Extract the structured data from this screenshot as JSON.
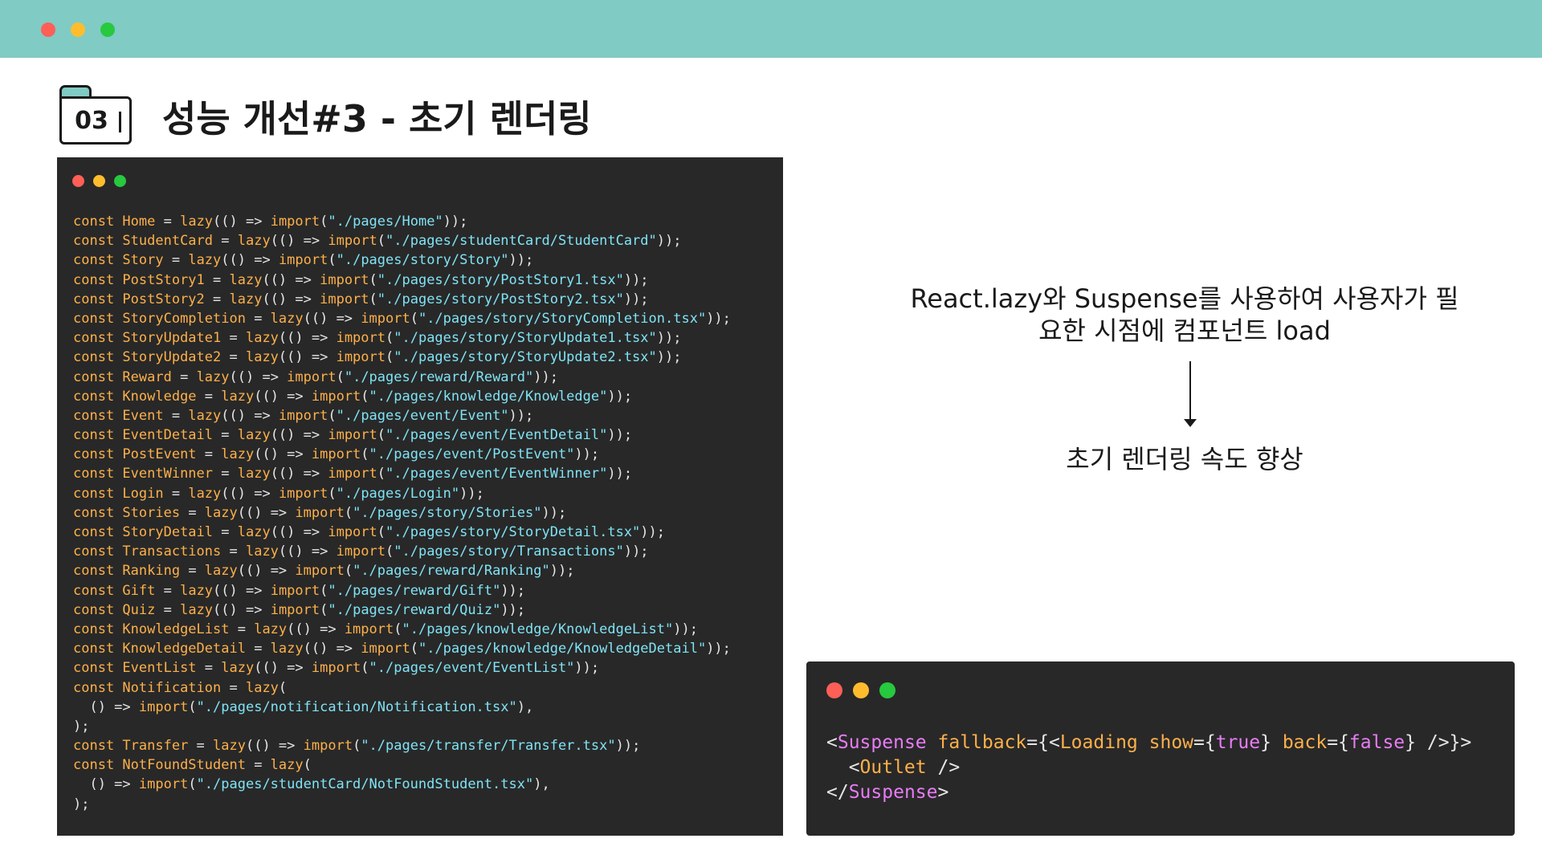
{
  "slide": {
    "section_number": "03",
    "title": "성능 개선#3 - 초기 렌더링"
  },
  "colors": {
    "topbar": "#80cbc4",
    "code_bg": "#282828",
    "keyword": "#fdb04a",
    "string": "#7fe3f5",
    "jsx_tag": "#e87cf5"
  },
  "left_code": {
    "lines": [
      [
        [
          "kw",
          "const "
        ],
        [
          "id",
          "Home"
        ],
        [
          "pn",
          " = "
        ],
        [
          "fn",
          "lazy"
        ],
        [
          "pn",
          "(() => "
        ],
        [
          "fn",
          "import"
        ],
        [
          "pn",
          "("
        ],
        [
          "str",
          "\"./pages/Home\""
        ],
        [
          "pn",
          "));"
        ]
      ],
      [
        [
          "kw",
          "const "
        ],
        [
          "id",
          "StudentCard"
        ],
        [
          "pn",
          " = "
        ],
        [
          "fn",
          "lazy"
        ],
        [
          "pn",
          "(() => "
        ],
        [
          "fn",
          "import"
        ],
        [
          "pn",
          "("
        ],
        [
          "str",
          "\"./pages/studentCard/StudentCard\""
        ],
        [
          "pn",
          "));"
        ]
      ],
      [
        [
          "kw",
          "const "
        ],
        [
          "id",
          "Story"
        ],
        [
          "pn",
          " = "
        ],
        [
          "fn",
          "lazy"
        ],
        [
          "pn",
          "(() => "
        ],
        [
          "fn",
          "import"
        ],
        [
          "pn",
          "("
        ],
        [
          "str",
          "\"./pages/story/Story\""
        ],
        [
          "pn",
          "));"
        ]
      ],
      [
        [
          "kw",
          "const "
        ],
        [
          "id",
          "PostStory1"
        ],
        [
          "pn",
          " = "
        ],
        [
          "fn",
          "lazy"
        ],
        [
          "pn",
          "(() => "
        ],
        [
          "fn",
          "import"
        ],
        [
          "pn",
          "("
        ],
        [
          "str",
          "\"./pages/story/PostStory1.tsx\""
        ],
        [
          "pn",
          "));"
        ]
      ],
      [
        [
          "kw",
          "const "
        ],
        [
          "id",
          "PostStory2"
        ],
        [
          "pn",
          " = "
        ],
        [
          "fn",
          "lazy"
        ],
        [
          "pn",
          "(() => "
        ],
        [
          "fn",
          "import"
        ],
        [
          "pn",
          "("
        ],
        [
          "str",
          "\"./pages/story/PostStory2.tsx\""
        ],
        [
          "pn",
          "));"
        ]
      ],
      [
        [
          "kw",
          "const "
        ],
        [
          "id",
          "StoryCompletion"
        ],
        [
          "pn",
          " = "
        ],
        [
          "fn",
          "lazy"
        ],
        [
          "pn",
          "(() => "
        ],
        [
          "fn",
          "import"
        ],
        [
          "pn",
          "("
        ],
        [
          "str",
          "\"./pages/story/StoryCompletion.tsx\""
        ],
        [
          "pn",
          "));"
        ]
      ],
      [
        [
          "kw",
          "const "
        ],
        [
          "id",
          "StoryUpdate1"
        ],
        [
          "pn",
          " = "
        ],
        [
          "fn",
          "lazy"
        ],
        [
          "pn",
          "(() => "
        ],
        [
          "fn",
          "import"
        ],
        [
          "pn",
          "("
        ],
        [
          "str",
          "\"./pages/story/StoryUpdate1.tsx\""
        ],
        [
          "pn",
          "));"
        ]
      ],
      [
        [
          "kw",
          "const "
        ],
        [
          "id",
          "StoryUpdate2"
        ],
        [
          "pn",
          " = "
        ],
        [
          "fn",
          "lazy"
        ],
        [
          "pn",
          "(() => "
        ],
        [
          "fn",
          "import"
        ],
        [
          "pn",
          "("
        ],
        [
          "str",
          "\"./pages/story/StoryUpdate2.tsx\""
        ],
        [
          "pn",
          "));"
        ]
      ],
      [
        [
          "kw",
          "const "
        ],
        [
          "id",
          "Reward"
        ],
        [
          "pn",
          " = "
        ],
        [
          "fn",
          "lazy"
        ],
        [
          "pn",
          "(() => "
        ],
        [
          "fn",
          "import"
        ],
        [
          "pn",
          "("
        ],
        [
          "str",
          "\"./pages/reward/Reward\""
        ],
        [
          "pn",
          "));"
        ]
      ],
      [
        [
          "kw",
          "const "
        ],
        [
          "id",
          "Knowledge"
        ],
        [
          "pn",
          " = "
        ],
        [
          "fn",
          "lazy"
        ],
        [
          "pn",
          "(() => "
        ],
        [
          "fn",
          "import"
        ],
        [
          "pn",
          "("
        ],
        [
          "str",
          "\"./pages/knowledge/Knowledge\""
        ],
        [
          "pn",
          "));"
        ]
      ],
      [
        [
          "kw",
          "const "
        ],
        [
          "id",
          "Event"
        ],
        [
          "pn",
          " = "
        ],
        [
          "fn",
          "lazy"
        ],
        [
          "pn",
          "(() => "
        ],
        [
          "fn",
          "import"
        ],
        [
          "pn",
          "("
        ],
        [
          "str",
          "\"./pages/event/Event\""
        ],
        [
          "pn",
          "));"
        ]
      ],
      [
        [
          "kw",
          "const "
        ],
        [
          "id",
          "EventDetail"
        ],
        [
          "pn",
          " = "
        ],
        [
          "fn",
          "lazy"
        ],
        [
          "pn",
          "(() => "
        ],
        [
          "fn",
          "import"
        ],
        [
          "pn",
          "("
        ],
        [
          "str",
          "\"./pages/event/EventDetail\""
        ],
        [
          "pn",
          "));"
        ]
      ],
      [
        [
          "kw",
          "const "
        ],
        [
          "id",
          "PostEvent"
        ],
        [
          "pn",
          " = "
        ],
        [
          "fn",
          "lazy"
        ],
        [
          "pn",
          "(() => "
        ],
        [
          "fn",
          "import"
        ],
        [
          "pn",
          "("
        ],
        [
          "str",
          "\"./pages/event/PostEvent\""
        ],
        [
          "pn",
          "));"
        ]
      ],
      [
        [
          "kw",
          "const "
        ],
        [
          "id",
          "EventWinner"
        ],
        [
          "pn",
          " = "
        ],
        [
          "fn",
          "lazy"
        ],
        [
          "pn",
          "(() => "
        ],
        [
          "fn",
          "import"
        ],
        [
          "pn",
          "("
        ],
        [
          "str",
          "\"./pages/event/EventWinner\""
        ],
        [
          "pn",
          "));"
        ]
      ],
      [
        [
          "kw",
          "const "
        ],
        [
          "id",
          "Login"
        ],
        [
          "pn",
          " = "
        ],
        [
          "fn",
          "lazy"
        ],
        [
          "pn",
          "(() => "
        ],
        [
          "fn",
          "import"
        ],
        [
          "pn",
          "("
        ],
        [
          "str",
          "\"./pages/Login\""
        ],
        [
          "pn",
          "));"
        ]
      ],
      [
        [
          "kw",
          "const "
        ],
        [
          "id",
          "Stories"
        ],
        [
          "pn",
          " = "
        ],
        [
          "fn",
          "lazy"
        ],
        [
          "pn",
          "(() => "
        ],
        [
          "fn",
          "import"
        ],
        [
          "pn",
          "("
        ],
        [
          "str",
          "\"./pages/story/Stories\""
        ],
        [
          "pn",
          "));"
        ]
      ],
      [
        [
          "kw",
          "const "
        ],
        [
          "id",
          "StoryDetail"
        ],
        [
          "pn",
          " = "
        ],
        [
          "fn",
          "lazy"
        ],
        [
          "pn",
          "(() => "
        ],
        [
          "fn",
          "import"
        ],
        [
          "pn",
          "("
        ],
        [
          "str",
          "\"./pages/story/StoryDetail.tsx\""
        ],
        [
          "pn",
          "));"
        ]
      ],
      [
        [
          "kw",
          "const "
        ],
        [
          "id",
          "Transactions"
        ],
        [
          "pn",
          " = "
        ],
        [
          "fn",
          "lazy"
        ],
        [
          "pn",
          "(() => "
        ],
        [
          "fn",
          "import"
        ],
        [
          "pn",
          "("
        ],
        [
          "str",
          "\"./pages/story/Transactions\""
        ],
        [
          "pn",
          "));"
        ]
      ],
      [
        [
          "kw",
          "const "
        ],
        [
          "id",
          "Ranking"
        ],
        [
          "pn",
          " = "
        ],
        [
          "fn",
          "lazy"
        ],
        [
          "pn",
          "(() => "
        ],
        [
          "fn",
          "import"
        ],
        [
          "pn",
          "("
        ],
        [
          "str",
          "\"./pages/reward/Ranking\""
        ],
        [
          "pn",
          "));"
        ]
      ],
      [
        [
          "kw",
          "const "
        ],
        [
          "id",
          "Gift"
        ],
        [
          "pn",
          " = "
        ],
        [
          "fn",
          "lazy"
        ],
        [
          "pn",
          "(() => "
        ],
        [
          "fn",
          "import"
        ],
        [
          "pn",
          "("
        ],
        [
          "str",
          "\"./pages/reward/Gift\""
        ],
        [
          "pn",
          "));"
        ]
      ],
      [
        [
          "kw",
          "const "
        ],
        [
          "id",
          "Quiz"
        ],
        [
          "pn",
          " = "
        ],
        [
          "fn",
          "lazy"
        ],
        [
          "pn",
          "(() => "
        ],
        [
          "fn",
          "import"
        ],
        [
          "pn",
          "("
        ],
        [
          "str",
          "\"./pages/reward/Quiz\""
        ],
        [
          "pn",
          "));"
        ]
      ],
      [
        [
          "kw",
          "const "
        ],
        [
          "id",
          "KnowledgeList"
        ],
        [
          "pn",
          " = "
        ],
        [
          "fn",
          "lazy"
        ],
        [
          "pn",
          "(() => "
        ],
        [
          "fn",
          "import"
        ],
        [
          "pn",
          "("
        ],
        [
          "str",
          "\"./pages/knowledge/KnowledgeList\""
        ],
        [
          "pn",
          "));"
        ]
      ],
      [
        [
          "kw",
          "const "
        ],
        [
          "id",
          "KnowledgeDetail"
        ],
        [
          "pn",
          " = "
        ],
        [
          "fn",
          "lazy"
        ],
        [
          "pn",
          "(() => "
        ],
        [
          "fn",
          "import"
        ],
        [
          "pn",
          "("
        ],
        [
          "str",
          "\"./pages/knowledge/KnowledgeDetail\""
        ],
        [
          "pn",
          "));"
        ]
      ],
      [
        [
          "kw",
          "const "
        ],
        [
          "id",
          "EventList"
        ],
        [
          "pn",
          " = "
        ],
        [
          "fn",
          "lazy"
        ],
        [
          "pn",
          "(() => "
        ],
        [
          "fn",
          "import"
        ],
        [
          "pn",
          "("
        ],
        [
          "str",
          "\"./pages/event/EventList\""
        ],
        [
          "pn",
          "));"
        ]
      ],
      [
        [
          "kw",
          "const "
        ],
        [
          "id",
          "Notification"
        ],
        [
          "pn",
          " = "
        ],
        [
          "fn",
          "lazy"
        ],
        [
          "pn",
          "("
        ]
      ],
      [
        [
          "pn",
          "  () => "
        ],
        [
          "fn",
          "import"
        ],
        [
          "pn",
          "("
        ],
        [
          "str",
          "\"./pages/notification/Notification.tsx\""
        ],
        [
          "pn",
          "),"
        ]
      ],
      [
        [
          "pn",
          ");"
        ]
      ],
      [
        [
          "kw",
          "const "
        ],
        [
          "id",
          "Transfer"
        ],
        [
          "pn",
          " = "
        ],
        [
          "fn",
          "lazy"
        ],
        [
          "pn",
          "(() => "
        ],
        [
          "fn",
          "import"
        ],
        [
          "pn",
          "("
        ],
        [
          "str",
          "\"./pages/transfer/Transfer.tsx\""
        ],
        [
          "pn",
          "));"
        ]
      ],
      [
        [
          "kw",
          "const "
        ],
        [
          "id",
          "NotFoundStudent"
        ],
        [
          "pn",
          " = "
        ],
        [
          "fn",
          "lazy"
        ],
        [
          "pn",
          "("
        ]
      ],
      [
        [
          "pn",
          "  () => "
        ],
        [
          "fn",
          "import"
        ],
        [
          "pn",
          "("
        ],
        [
          "str",
          "\"./pages/studentCard/NotFoundStudent.tsx\""
        ],
        [
          "pn",
          "),"
        ]
      ],
      [
        [
          "pn",
          ");"
        ]
      ]
    ]
  },
  "right_code": {
    "lines": [
      [
        [
          "pn",
          "<"
        ],
        [
          "tag",
          "Suspense"
        ],
        [
          "pn",
          " "
        ],
        [
          "attr",
          "fallback"
        ],
        [
          "pn",
          "={<"
        ],
        [
          "attr",
          "Loading"
        ],
        [
          "pn",
          " "
        ],
        [
          "attr",
          "show"
        ],
        [
          "pn",
          "={"
        ],
        [
          "bool",
          "true"
        ],
        [
          "pn",
          "} "
        ],
        [
          "attr",
          "back"
        ],
        [
          "pn",
          "={"
        ],
        [
          "bool",
          "false"
        ],
        [
          "pn",
          "} />}>"
        ]
      ],
      [
        [
          "pn",
          "  <"
        ],
        [
          "attr",
          "Outlet"
        ],
        [
          "pn",
          " />"
        ]
      ],
      [
        [
          "pn",
          "</"
        ],
        [
          "tag",
          "Suspense"
        ],
        [
          "pn",
          ">"
        ]
      ]
    ]
  },
  "explanation": {
    "line1": "React.lazy와 Suspense를 사용하여 사용자가 필",
    "line2": "요한 시점에 컴포넌트 load",
    "result": "초기 렌더링 속도 향상"
  }
}
